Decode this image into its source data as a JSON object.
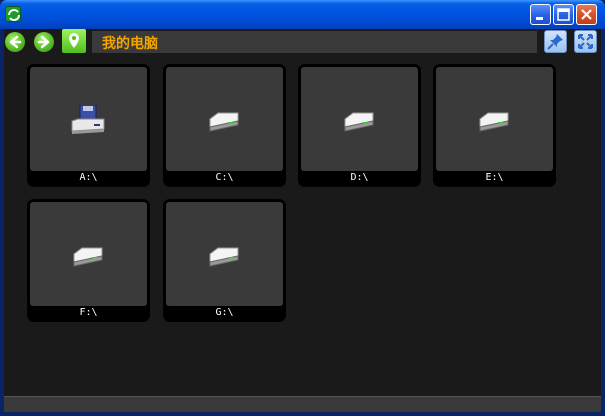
{
  "window": {
    "title": "",
    "controls": [
      "minimize",
      "maximize",
      "close"
    ]
  },
  "nav": {
    "back_icon": "back-arrow-icon",
    "forward_icon": "forward-arrow-icon",
    "location_icon": "location-pin-icon",
    "address": "我的电脑",
    "pin_icon": "pin-icon",
    "fullscreen_icon": "fullscreen-icon"
  },
  "drives": [
    {
      "label": "A:\\",
      "icon": "floppy-drive-icon"
    },
    {
      "label": "C:\\",
      "icon": "hard-drive-icon"
    },
    {
      "label": "D:\\",
      "icon": "hard-drive-icon"
    },
    {
      "label": "E:\\",
      "icon": "hard-drive-icon"
    },
    {
      "label": "F:\\",
      "icon": "hard-drive-icon"
    },
    {
      "label": "G:\\",
      "icon": "hard-drive-icon"
    }
  ],
  "colors": {
    "address_text": "#f2a400",
    "background": "#1a1a1a",
    "tile": "#3a3a3a",
    "titlebar": "#0054e3"
  }
}
